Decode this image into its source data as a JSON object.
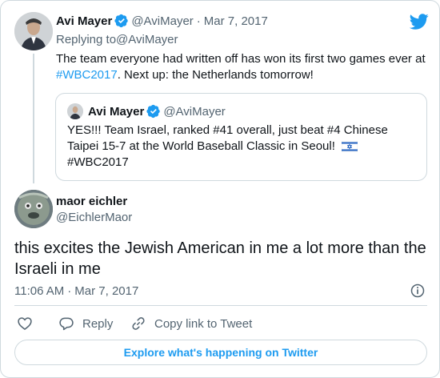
{
  "parent_tweet": {
    "author_name": "Avi Mayer",
    "author_handle": "@AviMayer",
    "separator": "·",
    "date": "Mar 7, 2017",
    "replying_prefix": "Replying to ",
    "replying_handle": "@AviMayer",
    "text_part1": "The team everyone had written off has won its first two games ever at",
    "hashtag": "#WBC2017",
    "text_part2": ". Next up: the Netherlands tomorrow!"
  },
  "quoted_tweet": {
    "author_name": "Avi Mayer",
    "author_handle": "@AviMayer",
    "line1": "YES!!! Team Israel, ranked #41 overall, just beat #4 Chinese",
    "line2": "Taipei 15-7 at the World Baseball Classic in Seoul!",
    "line3": "#WBC2017"
  },
  "main_tweet": {
    "author_name": "maor eichler",
    "author_handle": "@EichlerMaor",
    "text": "this excites the Jewish American in me a lot more than the Israeli in me",
    "time": "11:06 AM",
    "separator": "·",
    "date": "Mar 7, 2017"
  },
  "actions": {
    "reply_label": "Reply",
    "copy_link_label": "Copy link to Tweet"
  },
  "explore_label": "Explore what's happening on Twitter",
  "icons": {
    "brand": "twitter-bird-icon",
    "verified": "verified-badge-icon",
    "info": "info-icon",
    "like": "heart-icon",
    "reply": "reply-bubble-icon",
    "link": "link-icon",
    "flag": "israel-flag-emoji"
  },
  "colors": {
    "accent": "#1d9bf0",
    "muted": "#536471",
    "border": "#cfd9de",
    "text": "#0f1419"
  }
}
